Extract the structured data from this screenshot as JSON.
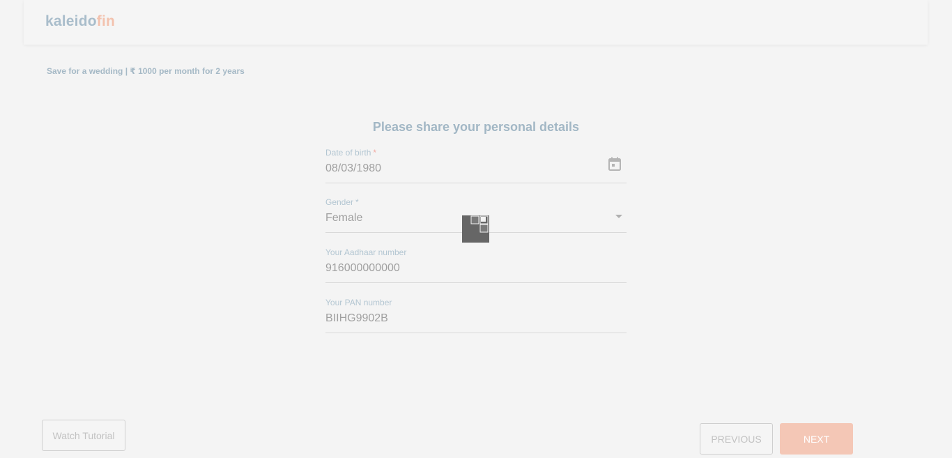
{
  "header": {
    "logo_part1": "kaleido",
    "logo_part2": "fin"
  },
  "plan_summary": "Save for a wedding | ₹ 1000 per month for 2 years",
  "form": {
    "title": "Please share your personal details",
    "dob": {
      "label": "Date of birth",
      "required": "*",
      "value": "08/03/1980",
      "icon": "calendar-icon"
    },
    "gender": {
      "label": "Gender",
      "required": "*",
      "value": "Female",
      "icon": "chevron-down-icon"
    },
    "aadhaar": {
      "label": "Your Aadhaar number",
      "value": "916000000000"
    },
    "pan": {
      "label": "Your PAN number",
      "value": "BIIHG9902B"
    }
  },
  "buttons": {
    "tutorial": "Watch Tutorial",
    "previous": "PREVIOUS",
    "next": "NEXT"
  },
  "colors": {
    "accent_blue": "#a9bdcb",
    "accent_orange": "#f3c2ae",
    "next_button": "#f4c7b6",
    "background": "#f4f4f4"
  },
  "loader": {
    "icon": "loading-spinner-icon"
  }
}
